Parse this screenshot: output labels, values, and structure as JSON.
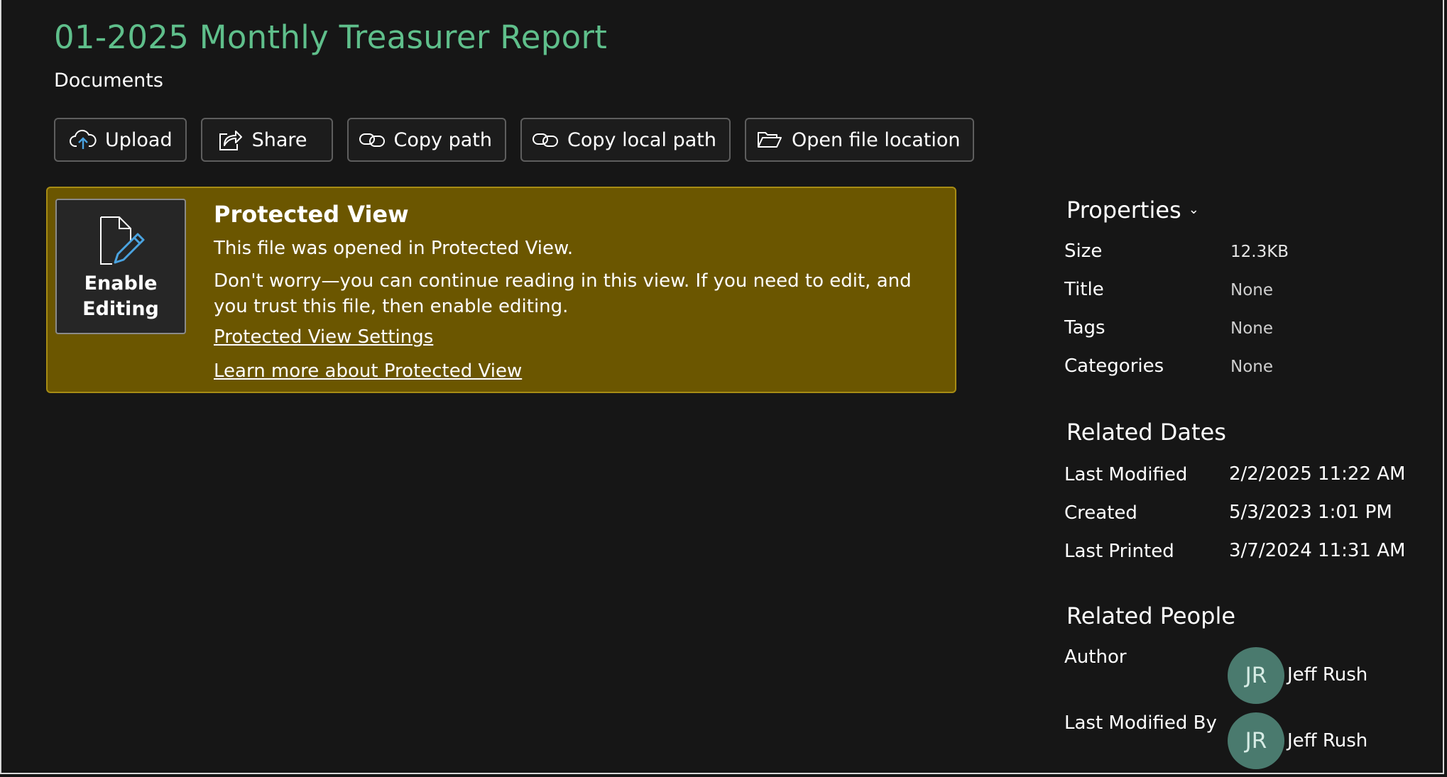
{
  "document": {
    "title": "01-2025 Monthly Treasurer Report",
    "location": "Documents"
  },
  "toolbar": {
    "upload": "Upload",
    "share": "Share",
    "copy_path": "Copy path",
    "copy_local_path": "Copy local path",
    "open_file_location": "Open file location"
  },
  "protected_view": {
    "button_label": "Enable\nEditing",
    "title": "Protected View",
    "line1": "This file was opened in Protected View.",
    "line2": "Don't worry—you can continue reading in this view. If you need to edit, and you trust this file, then enable editing.",
    "settings_link": "Protected View Settings",
    "learn_more_link": "Learn more about Protected View"
  },
  "properties": {
    "heading": "Properties",
    "size_label": "Size",
    "size_value": "12.3KB",
    "title_label": "Title",
    "title_value": "None",
    "tags_label": "Tags",
    "tags_value": "None",
    "categories_label": "Categories",
    "categories_value": "None"
  },
  "related_dates": {
    "heading": "Related Dates",
    "last_modified_label": "Last Modified",
    "last_modified_value": "2/2/2025 11:22 AM",
    "created_label": "Created",
    "created_value": "5/3/2023 1:01 PM",
    "last_printed_label": "Last Printed",
    "last_printed_value": "3/7/2024 11:31 AM"
  },
  "related_people": {
    "heading": "Related People",
    "author_label": "Author",
    "author_initials": "JR",
    "author_name": "Jeff Rush",
    "last_modified_by_label": "Last Modified By",
    "last_modified_by_initials": "JR",
    "last_modified_by_name": "Jeff Rush"
  },
  "colors": {
    "background": "#161616",
    "title_green": "#5fbf8b",
    "banner_fill": "#6b5600",
    "banner_border": "#a78c14",
    "avatar_fill": "#4a7a6e",
    "upload_arrow": "#4aa3e0"
  },
  "icons": {
    "upload": "cloud-upload-icon",
    "share": "share-icon",
    "copy_path": "link-icon",
    "copy_local_path": "link-icon",
    "open_file_location": "folder-open-icon",
    "enable_editing": "document-edit-icon",
    "properties_toggle": "chevron-down-icon"
  }
}
